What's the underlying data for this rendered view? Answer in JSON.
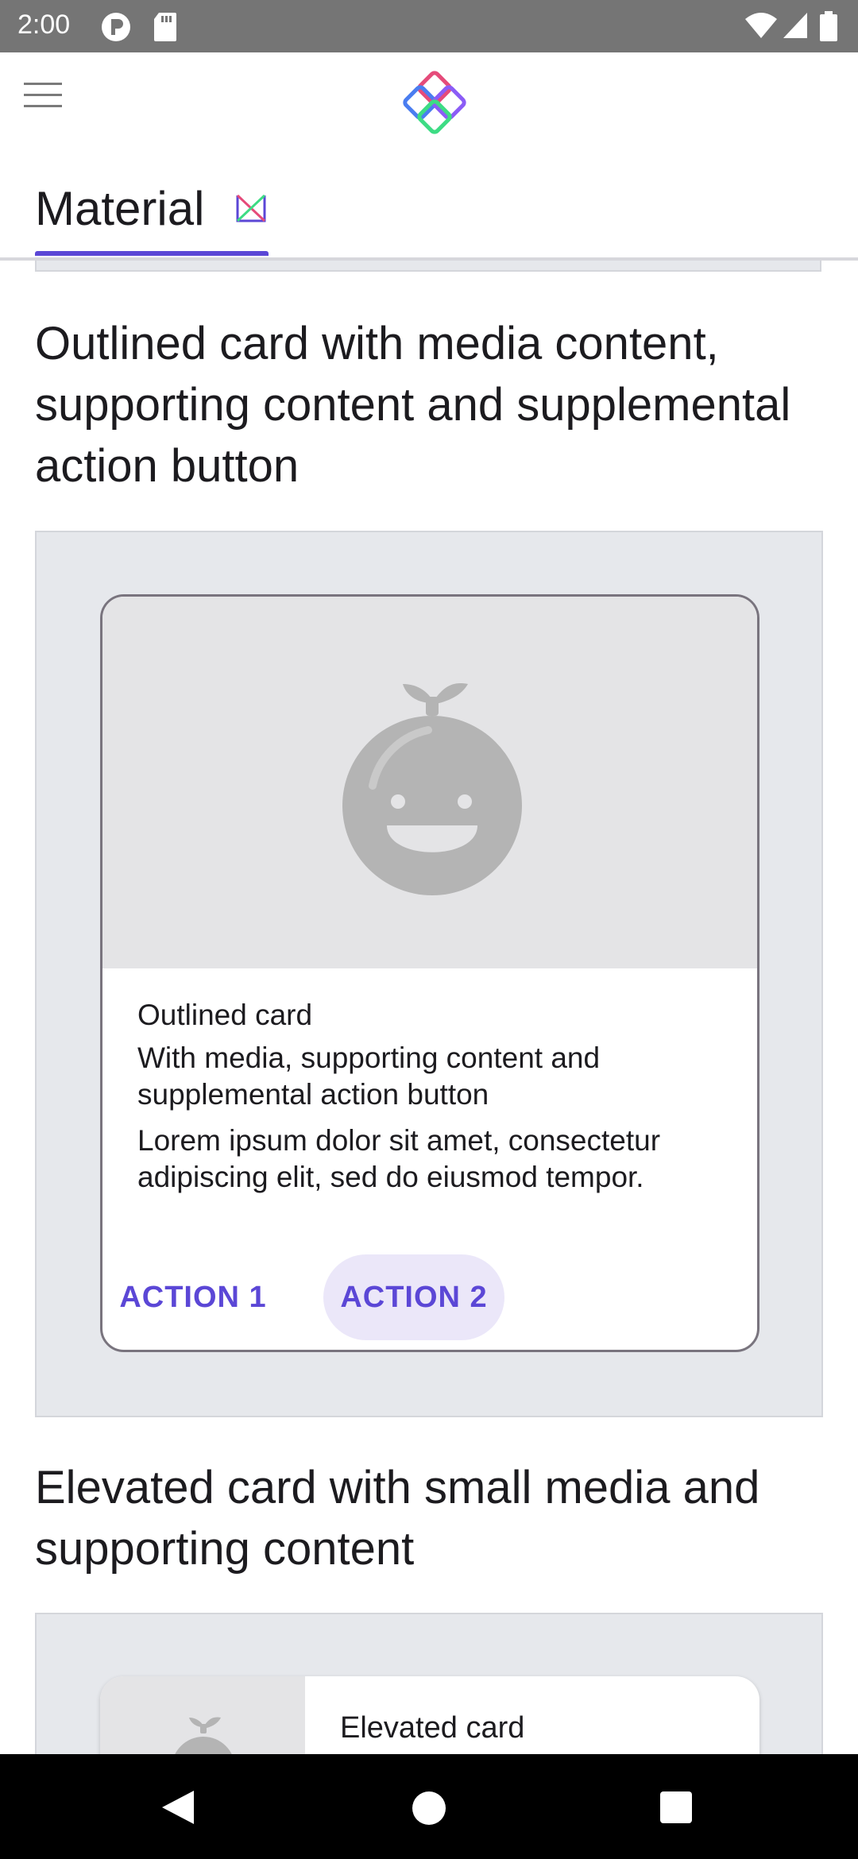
{
  "status_bar": {
    "time": "2:00"
  },
  "app_bar": {
    "menu_icon": "menu-icon",
    "logo_icon": "compose-catalog-logo-icon"
  },
  "tabs": [
    {
      "label": "Material",
      "selected": true,
      "badge_icon": "material-badge-icon"
    }
  ],
  "colors": {
    "accent": "#5b47d6",
    "tonal_button_bg": "#ebe7f9",
    "sample_bg": "#e6e8ec",
    "card_outline": "#79747e",
    "media_bg": "#e4e4e6",
    "placeholder_icon": "#b4b4b4",
    "status_bar": "#757575"
  },
  "sections": [
    {
      "title": "Outlined card with media content, supporting content and supplemental action button",
      "card": {
        "media_icon": "fruit-placeholder-icon",
        "title": "Outlined card",
        "subtitle": "With media, supporting content and supplemental action button",
        "body": "Lorem ipsum dolor sit amet, consectetur adipiscing elit, sed do eiusmod tempor.",
        "action_1": "ACTION 1",
        "action_2": "ACTION 2"
      }
    },
    {
      "title": "Elevated card with small media and supporting content",
      "card": {
        "media_icon": "fruit-placeholder-icon",
        "title": "Elevated card"
      }
    }
  ],
  "nav_bar": {
    "back_icon": "back-icon",
    "home_icon": "home-icon",
    "recents_icon": "recents-icon"
  }
}
